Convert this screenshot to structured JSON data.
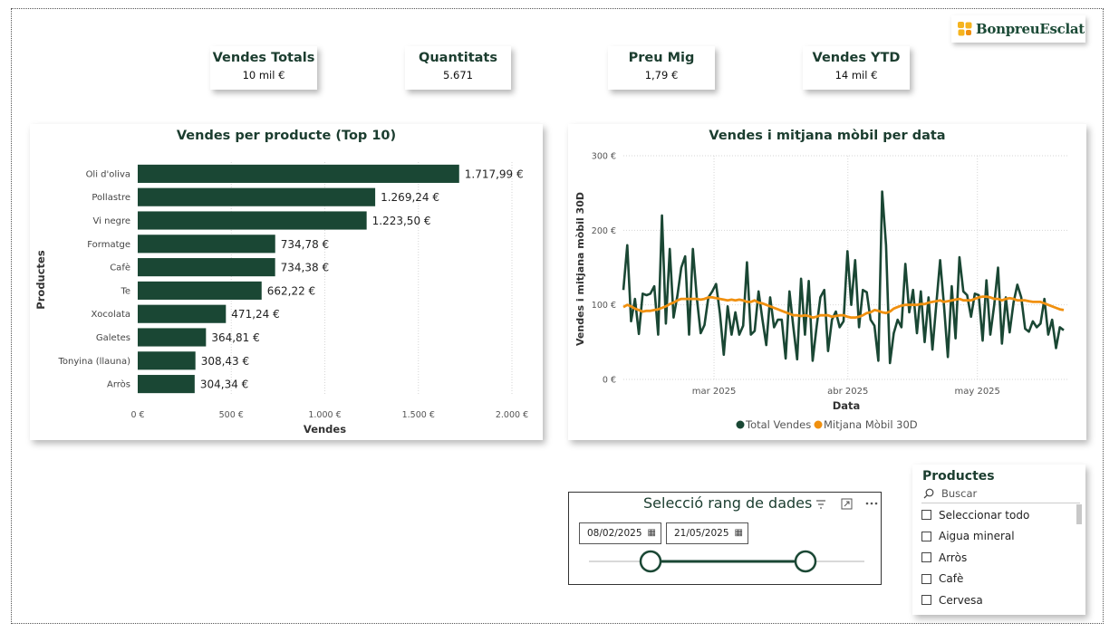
{
  "brand": {
    "name": "BonpreuEsclat",
    "colors": {
      "primary": "#1a4734",
      "accent": "#f0900f",
      "logo_yellow": "#f5b41f"
    }
  },
  "kpis": [
    {
      "title": "Vendes Totals",
      "value": "10 mil €"
    },
    {
      "title": "Quantitats",
      "value": "5.671"
    },
    {
      "title": "Preu Mig",
      "value": "1,79 €"
    },
    {
      "title": "Vendes YTD",
      "value": "14 mil €"
    }
  ],
  "bar_card": {
    "title": "Vendes per producte (Top 10)"
  },
  "line_card": {
    "title": "Vendes i mitjana mòbil per data"
  },
  "chart_data": [
    {
      "type": "bar",
      "orientation": "horizontal",
      "title": "Vendes per producte (Top 10)",
      "xlabel": "Vendes",
      "ylabel": "Productes",
      "categories": [
        "Oli d'oliva",
        "Pollastre",
        "Vi negre",
        "Formatge",
        "Cafè",
        "Te",
        "Xocolata",
        "Galetes",
        "Tonyina (llauna)",
        "Arròs"
      ],
      "values": [
        1717.99,
        1269.24,
        1223.5,
        734.78,
        734.38,
        662.22,
        471.24,
        364.81,
        308.43,
        304.34
      ],
      "value_labels": [
        "1.717,99 €",
        "1.269,24 €",
        "1.223,50 €",
        "734,78 €",
        "734,38 €",
        "662,22 €",
        "471,24 €",
        "364,81 €",
        "308,43 €",
        "304,34 €"
      ],
      "xlim": [
        0,
        2000
      ],
      "x_ticks": [
        "0 €",
        "500 €",
        "1.000 €",
        "1.500 €",
        "2.000 €"
      ],
      "grid": true,
      "color": "#1a4734"
    },
    {
      "type": "line",
      "title": "Vendes i mitjana mòbil per data",
      "xlabel": "Data",
      "ylabel": "Vendes i mitjana mòbil 30D",
      "x_range": [
        "2025-02-08",
        "2025-05-21"
      ],
      "x_ticks": [
        "mar 2025",
        "abr 2025",
        "may 2025"
      ],
      "y_ticks": [
        "0 €",
        "100 €",
        "200 €",
        "300 €"
      ],
      "ylim": [
        0,
        300
      ],
      "grid": true,
      "legend_position": "bottom",
      "series": [
        {
          "name": "Total Vendes",
          "color": "#1a4734",
          "values": [
            120,
            180,
            78,
            108,
            61,
            115,
            113,
            115,
            125,
            60,
            220,
            75,
            175,
            83,
            113,
            150,
            165,
            60,
            175,
            110,
            62,
            73,
            110,
            118,
            128,
            88,
            33,
            98,
            60,
            90,
            60,
            72,
            157,
            60,
            65,
            118,
            80,
            46,
            110,
            70,
            80,
            80,
            28,
            118,
            70,
            27,
            135,
            60,
            132,
            25,
            70,
            110,
            120,
            38,
            80,
            91,
            70,
            78,
            172,
            100,
            160,
            70,
            120,
            117,
            80,
            72,
            25,
            252,
            180,
            22,
            62,
            80,
            70,
            155,
            90,
            120,
            62,
            118,
            50,
            110,
            40,
            100,
            160,
            100,
            30,
            125,
            55,
            164,
            118,
            113,
            84,
            115,
            113,
            52,
            133,
            60,
            100,
            150,
            48,
            110,
            63,
            103,
            127,
            110,
            68,
            64,
            78,
            70,
            75,
            108,
            60,
            80,
            42,
            70,
            66
          ]
        },
        {
          "name": "Mitjana Mòbil 30D",
          "color": "#f0900f",
          "values": [
            97,
            100,
            98,
            95,
            93,
            91,
            92,
            92,
            93,
            94,
            96,
            98,
            101,
            103,
            106,
            108,
            108,
            108,
            108,
            108,
            107,
            108,
            110,
            110,
            109,
            108,
            107,
            106,
            107,
            106,
            107,
            106,
            104,
            104,
            106,
            103,
            102,
            100,
            98,
            96,
            94,
            92,
            90,
            88,
            86,
            86,
            85,
            86,
            85,
            83,
            84,
            86,
            86,
            86,
            84,
            85,
            86,
            86,
            84,
            83,
            83,
            84,
            86,
            89,
            90,
            93,
            92,
            90,
            89,
            91,
            95,
            97,
            99,
            100,
            100,
            100,
            100,
            101,
            101,
            103,
            104,
            105,
            106,
            104,
            105,
            106,
            107,
            108,
            106,
            106,
            106,
            108,
            110,
            111,
            111,
            110,
            108,
            108,
            106,
            108,
            109,
            108,
            106,
            106,
            106,
            105,
            104,
            104,
            104,
            102,
            100,
            98,
            96,
            94,
            93
          ]
        }
      ]
    }
  ],
  "date_range": {
    "title": "Selecció rang de dades",
    "start": "08/02/2025",
    "end": "21/05/2025"
  },
  "products_slicer": {
    "title": "Productes",
    "search_placeholder": "Buscar",
    "items": [
      "Seleccionar todo",
      "Aigua mineral",
      "Arròs",
      "Cafè",
      "Cervesa"
    ]
  }
}
